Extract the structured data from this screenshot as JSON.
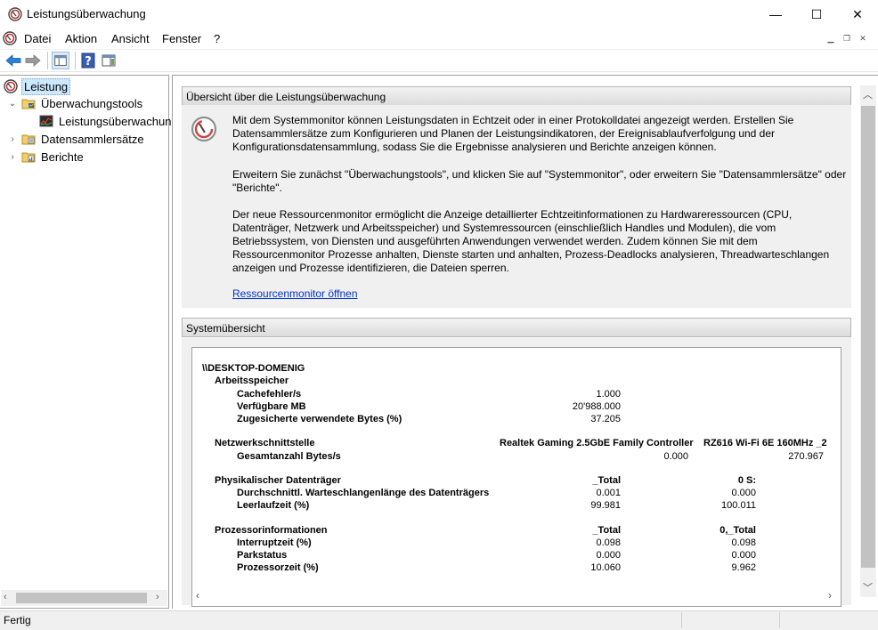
{
  "window": {
    "title": "Leistungsüberwachung",
    "minimize": "—",
    "maximize": "☐",
    "close": "✕"
  },
  "menu": {
    "file": "Datei",
    "action": "Aktion",
    "view": "Ansicht",
    "window": "Fenster",
    "help": "?"
  },
  "tree": {
    "root": "Leistung",
    "monitoring_tools": "Überwachungstools",
    "performance_monitor": "Leistungsüberwachung",
    "data_collector_sets": "Datensammlersätze",
    "reports": "Berichte"
  },
  "overview": {
    "header": "Übersicht über die Leistungsüberwachung",
    "para1": "Mit dem Systemmonitor können Leistungsdaten in Echtzeit oder in einer Protokolldatei angezeigt werden. Erstellen Sie Datensammlersätze zum Konfigurieren und Planen der Leistungsindikatoren, der Ereignisablaufverfolgung und der Konfigurationsdatensammlung, sodass Sie die Ergebnisse analysieren und Berichte anzeigen können.",
    "para2": "Erweitern Sie zunächst \"Überwachungstools\", und klicken Sie auf \"Systemmonitor\", oder erweitern Sie \"Datensammlersätze\" oder \"Berichte\".",
    "para3": "Der neue Ressourcenmonitor ermöglicht die Anzeige detaillierter Echtzeitinformationen zu Hardwareressourcen (CPU, Datenträger, Netzwerk und Arbeitsspeicher) und Systemressourcen (einschließlich Handles und Modulen), die vom Betriebssystem, von Diensten und ausgeführten Anwendungen verwendet werden. Zudem können Sie mit dem Ressourcenmonitor Prozesse anhalten, Dienste starten und anhalten, Prozess-Deadlocks analysieren, Threadwarteschlangen anzeigen und Prozesse identifizieren, die Dateien sperren.",
    "link": "Ressourcenmonitor öffnen"
  },
  "system": {
    "header": "Systemübersicht",
    "machine": "\\\\DESKTOP-DOMENIG",
    "memory": {
      "title": "Arbeitsspeicher",
      "rows": [
        {
          "label": "Cachefehler/s",
          "v1": "1.000"
        },
        {
          "label": "Verfügbare MB",
          "v1": "20'988.000"
        },
        {
          "label": "Zugesicherte verwendete Bytes (%)",
          "v1": "37.205"
        }
      ]
    },
    "network": {
      "title": "Netzwerkschnittstelle",
      "col1": "Realtek Gaming 2.5GbE Family Controller",
      "col2": "RZ616 Wi-Fi 6E 160MHz _2",
      "rows": [
        {
          "label": "Gesamtanzahl Bytes/s",
          "v1": "0.000",
          "v2": "270.967"
        }
      ]
    },
    "disk": {
      "title": "Physikalischer Datenträger",
      "col1": "_Total",
      "col2": "0 S:",
      "rows": [
        {
          "label": "Durchschnittl. Warteschlangenlänge des Datenträgers",
          "v1": "0.001",
          "v2": "0.000"
        },
        {
          "label": "Leerlaufzeit (%)",
          "v1": "99.981",
          "v2": "100.011"
        }
      ]
    },
    "cpu": {
      "title": "Prozessorinformationen",
      "col1": "_Total",
      "col2": "0,_Total",
      "rows": [
        {
          "label": "Interruptzeit (%)",
          "v1": "0.098",
          "v2": "0.098"
        },
        {
          "label": "Parkstatus",
          "v1": "0.000",
          "v2": "0.000"
        },
        {
          "label": "Prozessorzeit (%)",
          "v1": "10.060",
          "v2": "9.962"
        }
      ]
    }
  },
  "status": {
    "text": "Fertig"
  },
  "colors": {
    "selection": "#cce8ff",
    "link": "#0033cc",
    "panel_bg": "#f0f0f0"
  }
}
